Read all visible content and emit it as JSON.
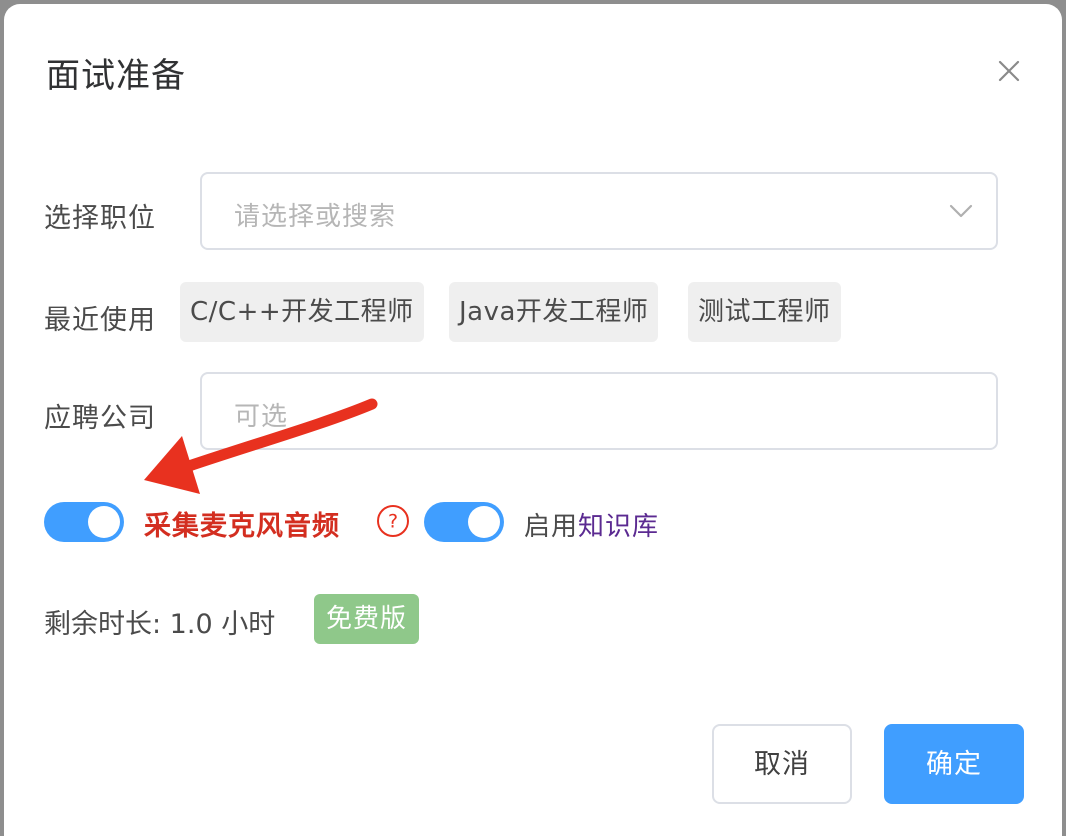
{
  "dialog": {
    "title": "面试准备",
    "close_icon": "close-icon"
  },
  "form": {
    "position": {
      "label": "选择职位",
      "placeholder": "请选择或搜索",
      "dropdown_icon": "chevron-down-icon"
    },
    "recent": {
      "label": "最近使用",
      "items": [
        "C/C++开发工程师",
        "Java开发工程师",
        "测试工程师"
      ]
    },
    "company": {
      "label": "应聘公司",
      "placeholder": "可选"
    }
  },
  "toggles": {
    "mic": {
      "label": "采集麦克风音频",
      "on": true,
      "help_icon": "question-circle-icon"
    },
    "knowledge": {
      "label_prefix": "启用",
      "link_text": "知识库",
      "on": true
    }
  },
  "status": {
    "remaining": "剩余时长: 1.0 小时",
    "plan_badge": "免费版"
  },
  "footer": {
    "cancel_label": "取消",
    "ok_label": "确定"
  },
  "colors": {
    "accent": "#409eff",
    "annotation_red": "#e8311f",
    "badge_green": "#8fc88a",
    "link_purple": "#5b2a91"
  }
}
